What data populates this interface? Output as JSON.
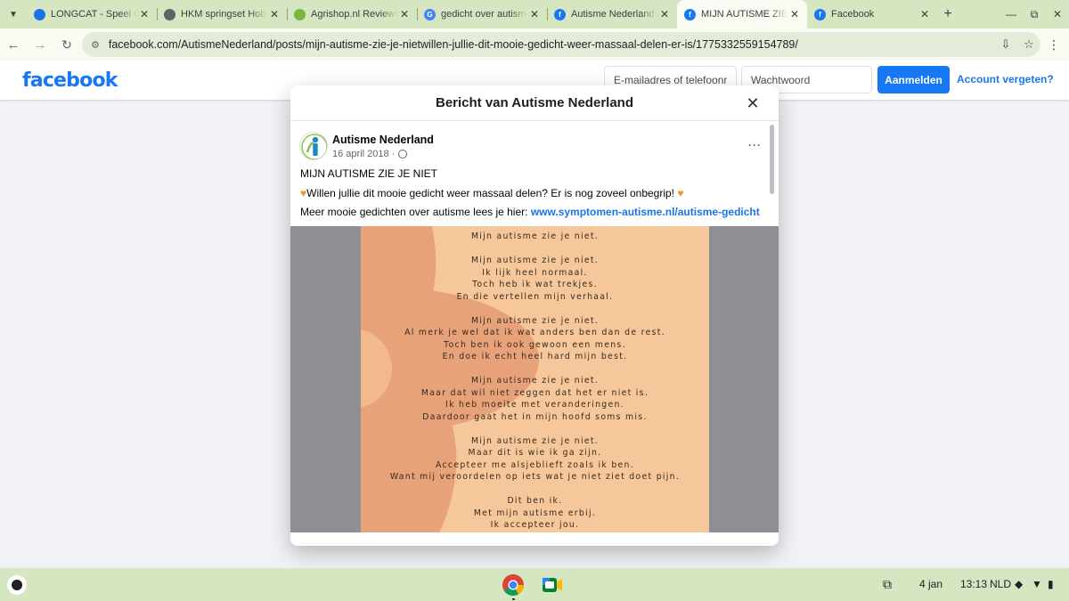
{
  "browser": {
    "tabs": [
      {
        "title": "LONGCAT - Speel Grat",
        "favicon_color": "#1a73e8",
        "favicon_text": "",
        "active": false
      },
      {
        "title": "HKM springset Hobby",
        "favicon_color": "#5f6368",
        "favicon_text": "",
        "active": false
      },
      {
        "title": "Agrishop.nl Reviews |",
        "favicon_color": "#7cb342",
        "favicon_text": "",
        "active": false
      },
      {
        "title": "gedicht over autisme",
        "favicon_color": "#4285f4",
        "favicon_text": "G",
        "active": false
      },
      {
        "title": "Autisme Nederland | F",
        "favicon_color": "#1877f2",
        "favicon_text": "f",
        "active": false
      },
      {
        "title": "MIJN AUTISME ZIE JE",
        "favicon_color": "#1877f2",
        "favicon_text": "f",
        "active": true
      },
      {
        "title": "Facebook",
        "favicon_color": "#1877f2",
        "favicon_text": "f",
        "active": false
      }
    ],
    "new_tab": "+",
    "url": "facebook.com/AutismeNederland/posts/mijn-autisme-zie-je-nietwillen-jullie-dit-mooie-gedicht-weer-massaal-delen-er-is/1775332559154789/"
  },
  "fb_header": {
    "logo": "facebook",
    "email_placeholder": "E-mailadres of telefoonr",
    "password_placeholder": "Wachtwoord",
    "login_label": "Aanmelden",
    "forgot_label": "Account vergeten?"
  },
  "modal": {
    "title": "Bericht van Autisme Nederland",
    "close": "✕"
  },
  "post": {
    "page_name": "Autisme Nederland",
    "date": "16 april 2018 ·",
    "menu": "···",
    "headline": "MIJN AUTISME ZIE JE NIET",
    "line2": "Willen jullie dit mooie gedicht weer massaal delen? Er is nog zoveel onbegrip!",
    "line3_prefix": "Meer mooie gedichten over autisme lees je hier:",
    "line3_link": "www.symptomen-autisme.nl/autisme-gedicht"
  },
  "poem": {
    "lines": [
      "Mijn autisme zie je niet.",
      "",
      "Mijn autisme zie je niet.",
      "Ik lijk heel normaal.",
      "Toch heb ik wat trekjes.",
      "En die vertellen mijn verhaal.",
      "",
      "Mijn autisme zie je niet.",
      "Al merk je wel dat ik wat anders ben dan de rest.",
      "Toch ben ik ook gewoon een mens.",
      "En doe ik echt heel hard mijn best.",
      "",
      "Mijn autisme zie je niet.",
      "Maar dat wil niet zeggen dat het er niet is.",
      "Ik heb moeite met veranderingen.",
      "Daardoor gaat het in mijn hoofd soms mis.",
      "",
      "Mijn autisme zie je niet.",
      "Maar dit is wie ik ga zijn.",
      "Accepteer me alsjeblieft zoals ik ben.",
      "Want mij veroordelen op iets wat je niet ziet doet pijn.",
      "",
      "Dit ben ik.",
      "Met mijn autisme erbij.",
      "Ik accepteer jou."
    ]
  },
  "shelf": {
    "date": "4 jan",
    "time": "13:13",
    "locale": "NLD"
  },
  "colors": {
    "accent": "#1877f2",
    "browser_frame": "#d6e6c1",
    "poster_background": "#f5c79a",
    "poster_flower": "#e8a27a",
    "image_letterbox": "#8d8f95"
  }
}
